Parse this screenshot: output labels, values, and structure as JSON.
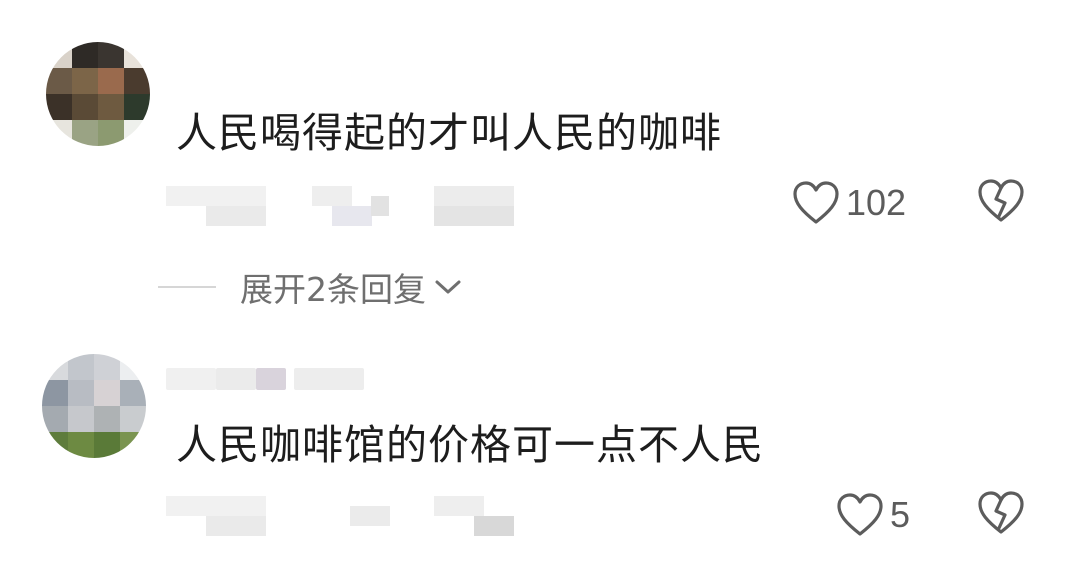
{
  "comments": [
    {
      "text": "人民喝得起的才叫人民的咖啡",
      "likes": "102",
      "avatar_icon": "pixelated-avatar",
      "username_visible": false,
      "replies_toggle": "展开2条回复"
    },
    {
      "text": "人民咖啡馆的价格可一点不人民",
      "likes": "5",
      "avatar_icon": "pixelated-avatar",
      "username_visible": false
    }
  ],
  "icons": {
    "like": "heart-outline-icon",
    "dislike": "broken-heart-icon",
    "expand": "chevron-down-icon"
  },
  "colors": {
    "text": "#1d1d1d",
    "meta": "#6f6f6f",
    "icon_stroke": "#5c5c5c",
    "divider": "#d6d6d6"
  }
}
